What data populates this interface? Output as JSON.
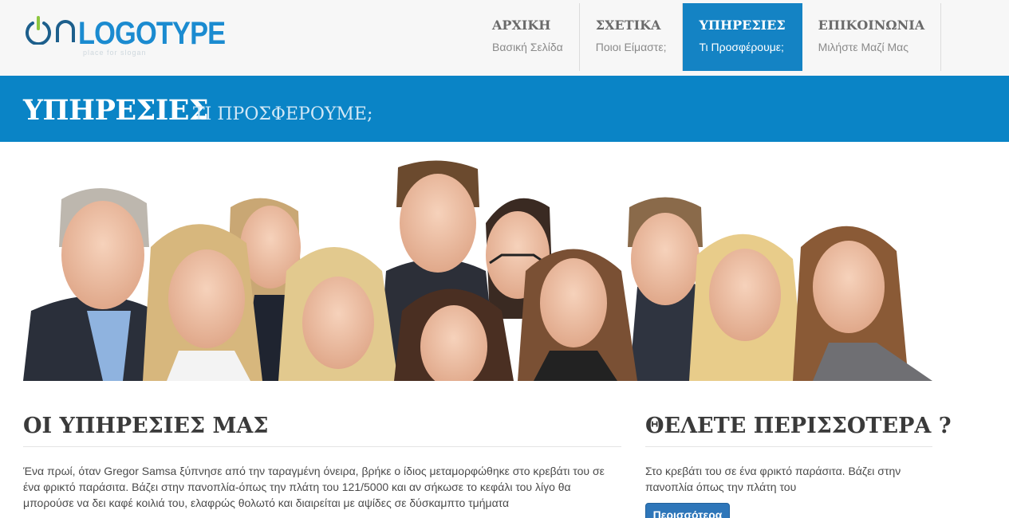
{
  "brand": {
    "logo_text": "LOGOTYPE",
    "slogan": "place for slogan"
  },
  "nav": [
    {
      "title": "ΑΡΧΙΚΗ",
      "sub": "Βασική Σελίδα",
      "active": false
    },
    {
      "title": "ΣΧΕΤΙΚΑ",
      "sub": "Ποιοι Είμαστε;",
      "active": false
    },
    {
      "title": "ΥΠΗΡΕΣΙΕΣ",
      "sub": "Τι Προσφέρουμε;",
      "active": true
    },
    {
      "title": "ΕΠΙΚΟΙΝΩΝΙΑ",
      "sub": "Μιλήστε Μαζί Μας",
      "active": false
    }
  ],
  "page": {
    "title": "ΥΠΗΡΕΣΙΕΣ",
    "subtitle": "ΤΙ ΠΡΟΣΦΕΡΟΥΜΕ;"
  },
  "services": {
    "title": "ΟΙ ΥΠΗΡΕΣΙΕΣ ΜΑΣ",
    "text": "Ένα πρωί, όταν Gregor Samsa ξύπνησε από την ταραγμένη όνειρα, βρήκε ο ίδιος μεταμορφώθηκε στο κρεβάτι του σε ένα φρικτό παράσιτα. Βάζει στην πανοπλία-όπως την πλάτη του 121/5000 και αν σήκωσε το κεφάλι του λίγο θα μπορούσε να δει καφέ κοιλιά του, ελαφρώς θολωτό και διαιρείται με αψίδες σε δύσκαμπτο τμήματα"
  },
  "more": {
    "title": "ΘΕΛΕΤΕ ΠΕΡΙΣΣΟΤΕΡΑ ?",
    "text": "Στο κρεβάτι του σε ένα φρικτό παράσιτα. Βάζει στην πανοπλία όπως την πλάτη του",
    "button": "Περισσότερα"
  },
  "colors": {
    "accent": "#0a84c6",
    "active_nav": "#1483c4",
    "button": "#2e76b9",
    "header_bg": "#f7f7f7"
  },
  "icons": {
    "logo": "power-icon"
  }
}
